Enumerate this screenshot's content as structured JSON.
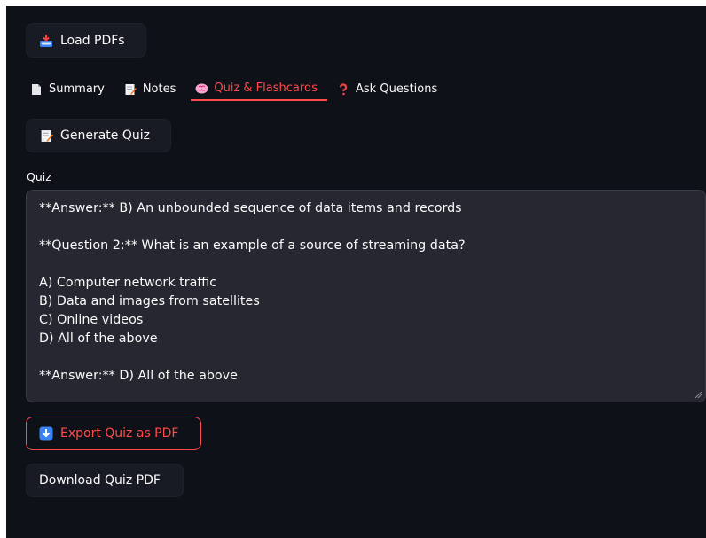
{
  "toolbar": {
    "load_label": "Load PDFs",
    "load_icon": "inbox-tray-icon"
  },
  "tabs": [
    {
      "label": "Summary",
      "icon": "page-icon",
      "active": false
    },
    {
      "label": "Notes",
      "icon": "memo-icon",
      "active": false
    },
    {
      "label": "Quiz & Flashcards",
      "icon": "brain-icon",
      "active": true
    },
    {
      "label": "Ask Questions",
      "icon": "question-mark-icon",
      "active": false
    }
  ],
  "quiz": {
    "generate_label": "Generate Quiz",
    "label": "Quiz",
    "content": "**Answer:** B) An unbounded sequence of data items and records\n\n**Question 2:** What is an example of a source of streaming data?\n\nA) Computer network traffic\nB) Data and images from satellites\nC) Online videos\nD) All of the above\n\n**Answer:** D) All of the above",
    "export_label": "Export Quiz as PDF",
    "download_label": "Download Quiz PDF"
  },
  "colors": {
    "background": "#0e1117",
    "accent": "#ff4b4b",
    "textarea_bg": "#262730"
  }
}
